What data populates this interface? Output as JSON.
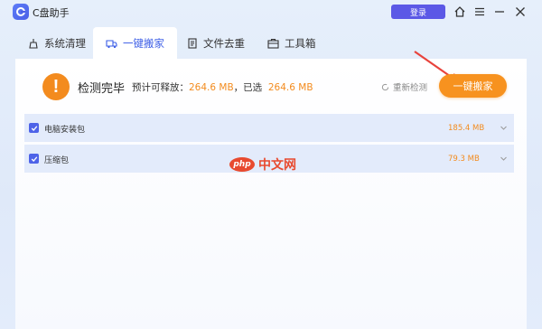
{
  "app": {
    "title": "C盘助手",
    "login_label": "登录"
  },
  "tabs": [
    {
      "label": "系统清理",
      "icon": "broom-icon"
    },
    {
      "label": "一键搬家",
      "icon": "truck-icon"
    },
    {
      "label": "文件去重",
      "icon": "file-duplicate-icon"
    },
    {
      "label": "工具箱",
      "icon": "toolbox-icon"
    }
  ],
  "status": {
    "title": "检测完毕",
    "releasable_label": "预计可释放：",
    "releasable_value": "264.6 MB",
    "selected_label": "，已选",
    "selected_value": "264.6 MB",
    "recheck_label": "重新检测",
    "move_button_label": "一键搬家"
  },
  "items": [
    {
      "label": "电脑安装包",
      "size": "185.4 MB",
      "checked": true
    },
    {
      "label": "压缩包",
      "size": "79.3 MB",
      "checked": true
    }
  ],
  "watermark": {
    "logo": "php",
    "text": "中文网"
  },
  "colors": {
    "accent": "#f38b1e",
    "primary": "#4e63e8",
    "login": "#5b58e6"
  }
}
